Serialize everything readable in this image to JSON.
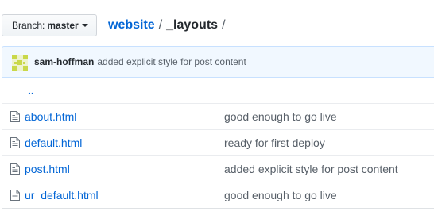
{
  "branch": {
    "label": "Branch:",
    "name": "master"
  },
  "breadcrumb": {
    "repo": "website",
    "separator": "/",
    "directory": "_layouts"
  },
  "latest_commit": {
    "author": "sam-hoffman",
    "message": "added explicit style for post content"
  },
  "parent_dir": "..",
  "files": [
    {
      "name": "about.html",
      "commit": "good enough to go live"
    },
    {
      "name": "default.html",
      "commit": "ready for first deploy"
    },
    {
      "name": "post.html",
      "commit": "added explicit style for post content"
    },
    {
      "name": "ur_default.html",
      "commit": "good enough to go live"
    }
  ],
  "colors": {
    "link": "#0366d6",
    "muted": "#586069",
    "commit_bar_bg": "#f1f8ff",
    "avatar": "#c9d84a"
  },
  "icons": {
    "avatar": "identicon-avatar",
    "file": "file-icon",
    "caret": "caret-down-icon"
  }
}
